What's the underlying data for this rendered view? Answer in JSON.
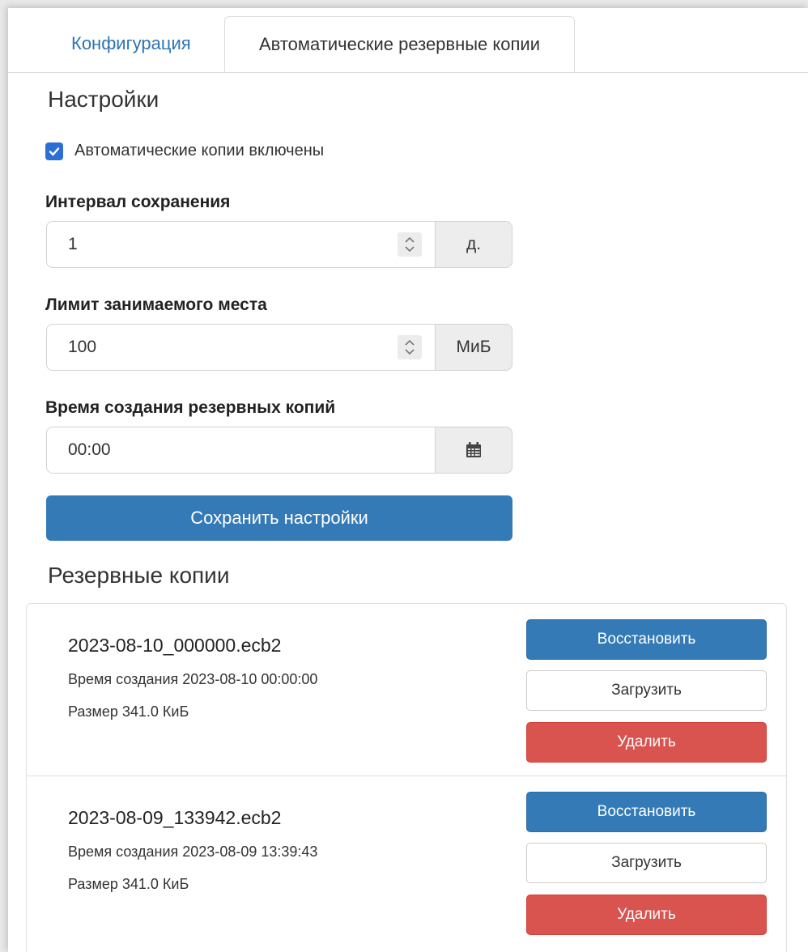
{
  "tabs": [
    {
      "label": "Конфигурация",
      "active": false
    },
    {
      "label": "Автоматические резервные копии",
      "active": true
    }
  ],
  "settings": {
    "heading": "Настройки",
    "auto_enabled_label": "Автоматические копии включены",
    "auto_enabled_checked": true,
    "interval": {
      "label": "Интервал сохранения",
      "value": "1",
      "unit": "д."
    },
    "limit": {
      "label": "Лимит занимаемого места",
      "value": "100",
      "unit": "МиБ"
    },
    "time": {
      "label": "Время создания резервных копий",
      "value": "00:00",
      "icon": "calendar-icon"
    },
    "save_label": "Сохранить настройки"
  },
  "backups": {
    "heading": "Резервные копии",
    "restore_label": "Восстановить",
    "download_label": "Загрузить",
    "delete_label": "Удалить",
    "items": [
      {
        "name": "2023-08-10_000000.ecb2",
        "created": "Время создания 2023-08-10 00:00:00",
        "size": "Размер 341.0 КиБ"
      },
      {
        "name": "2023-08-09_133942.ecb2",
        "created": "Время создания 2023-08-09 13:39:43",
        "size": "Размер 341.0 КиБ"
      }
    ]
  },
  "colors": {
    "primary": "#337ab7",
    "danger": "#d9534f",
    "checkbox": "#2b6fd6",
    "link": "#2d74b4"
  }
}
